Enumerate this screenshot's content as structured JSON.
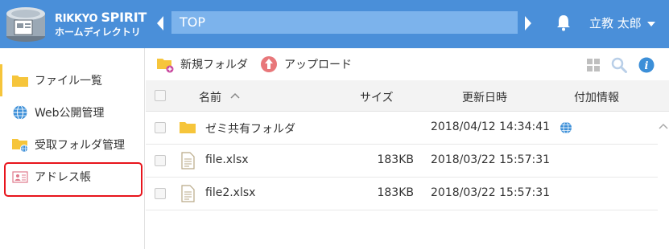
{
  "header": {
    "logo_line1_a": "RIKKYO ",
    "logo_line1_b": "SPIRIT",
    "logo_line2": "ホームディレクトリ",
    "path": "TOP",
    "user_name": "立教 太郎",
    "bg_color": "#4a8fd9"
  },
  "sidebar": {
    "items": [
      {
        "label": "ファイル一覧",
        "icon": "folder-icon",
        "active": true
      },
      {
        "label": "Web公開管理",
        "icon": "globe-icon"
      },
      {
        "label": "受取フォルダ管理",
        "icon": "folder-globe-icon"
      },
      {
        "label": "アドレス帳",
        "icon": "address-card-icon",
        "highlighted": true
      }
    ]
  },
  "toolbar": {
    "new_folder_label": "新規フォルダ",
    "upload_label": "アップロード"
  },
  "table": {
    "columns": {
      "name": "名前",
      "size": "サイズ",
      "updated": "更新日時",
      "extra": "付加情報"
    },
    "rows": [
      {
        "type": "folder",
        "name": "ゼミ共有フォルダ",
        "size": "",
        "updated": "2018/04/12 14:34:41",
        "web": true
      },
      {
        "type": "file",
        "name": "file.xlsx",
        "size": "183KB",
        "updated": "2018/03/22 15:57:31",
        "web": false
      },
      {
        "type": "file",
        "name": "file2.xlsx",
        "size": "183KB",
        "updated": "2018/03/22 15:57:31",
        "web": false
      }
    ]
  }
}
